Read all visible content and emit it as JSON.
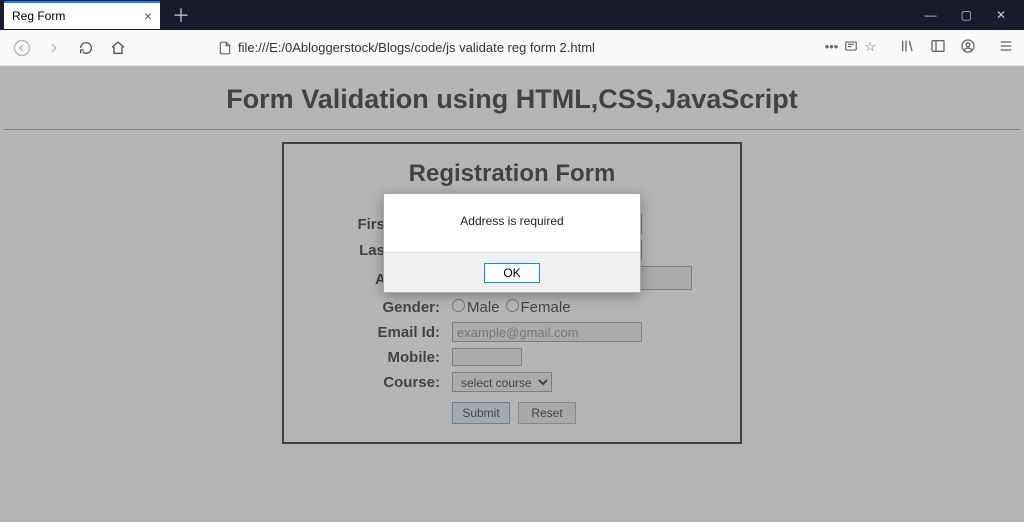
{
  "browser": {
    "tab_title": "Reg Form",
    "url": "file:///E:/0Abloggerstock/Blogs/code/js validate reg form 2.html"
  },
  "page": {
    "heading": "Form Validation using HTML,CSS,JavaScript",
    "form_title": "Registration Form",
    "labels": {
      "first_name": "First Name:",
      "last_name": "Last Name:",
      "address": "Address:",
      "gender": "Gender:",
      "email": "Email Id:",
      "mobile": "Mobile:",
      "course": "Course:"
    },
    "gender_options": {
      "male": "Male",
      "female": "Female"
    },
    "email_placeholder": "example@gmail.com",
    "course_selected": "select course",
    "buttons": {
      "submit": "Submit",
      "reset": "Reset"
    }
  },
  "alert": {
    "message": "Address is required",
    "ok": "OK"
  }
}
